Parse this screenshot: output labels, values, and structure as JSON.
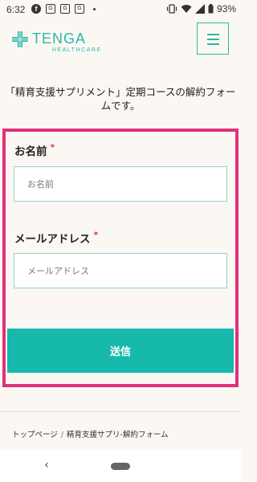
{
  "status_bar": {
    "time": "6:32",
    "battery": "93%",
    "notification_glyph": "f",
    "small_icons": [
      "G",
      "G",
      "G"
    ]
  },
  "header": {
    "logo_text": "TENGA",
    "logo_subtext": "HEALTHCARE",
    "brand_color": "#2ab8a8"
  },
  "page": {
    "title": "「精育支援サプリメント」定期コースの解約フォームです。"
  },
  "form": {
    "name_label": "お名前",
    "name_placeholder": "お名前",
    "email_label": "メールアドレス",
    "email_placeholder": "メールアドレス",
    "required_mark": "*",
    "submit_label": "送信",
    "highlight_color": "#e0317a",
    "button_color": "#16b9ab"
  },
  "breadcrumb": {
    "items": [
      "トップページ",
      "精育支援サプリ-解約フォーム"
    ],
    "separator": "/"
  },
  "nav_bar": {
    "back_glyph": "‹"
  }
}
